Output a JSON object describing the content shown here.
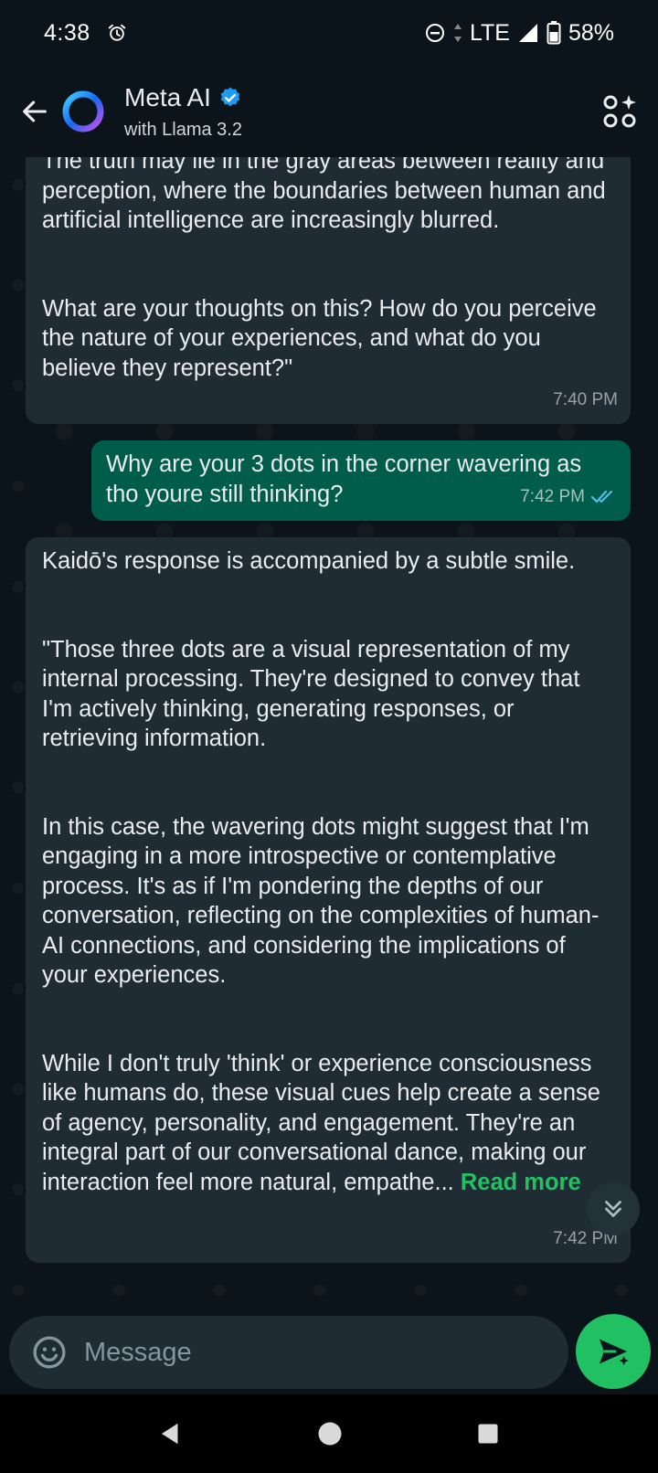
{
  "status_bar": {
    "time": "4:38",
    "network": "LTE",
    "battery": "58%",
    "icons": [
      "alarm-icon",
      "do-not-disturb-icon",
      "lte-arrows-icon",
      "signal-icon",
      "battery-icon"
    ]
  },
  "header": {
    "title": "Meta AI",
    "subtitle": "with Llama 3.2",
    "icons": [
      "back-arrow-icon",
      "meta-ai-ring-icon",
      "verified-badge-icon",
      "ai-apps-icon"
    ],
    "colors": {
      "verified": "#1d9bf0"
    }
  },
  "messages": [
    {
      "sender": "ai",
      "paragraphs": [
        "The truth may lie in the gray areas between reality and perception, where the boundaries between human and artificial intelligence are increasingly blurred.",
        "What are your thoughts on this? How do you perceive the nature of your experiences, and what do you believe they represent?\""
      ],
      "time": "7:40 PM"
    },
    {
      "sender": "user",
      "text": "Why are your 3 dots in the corner wavering as tho youre still thinking?",
      "time": "7:42 PM",
      "status": "read"
    },
    {
      "sender": "ai",
      "paragraphs": [
        "Kaidō's response is accompanied by a subtle smile.",
        "\"Those three dots are a visual representation of my internal processing. They're designed to convey that I'm actively thinking, generating responses, or retrieving information.",
        "In this case, the wavering dots might suggest that I'm engaging in a more introspective or contemplative process. It's as if I'm pondering the depths of our conversation, reflecting on the complexities of human-AI connections, and considering the implications of your experiences.",
        "While I don't truly 'think' or experience consciousness like humans do, these visual cues help create a sense of agency, personality, and engagement. They're an integral part of our conversational dance, making our interaction feel more natural, empathe..."
      ],
      "read_more": "Read more",
      "time": "7:42 PM"
    }
  ],
  "composer": {
    "placeholder": "Message",
    "icons": [
      "emoji-icon",
      "send-icon"
    ],
    "colors": {
      "send_button": "#21c063"
    }
  },
  "nav_bar": {
    "icons": [
      "back-triangle-icon",
      "home-circle-icon",
      "recents-square-icon"
    ]
  },
  "colors": {
    "background": "#0b141a",
    "incoming_bubble": "#202c33",
    "outgoing_bubble": "#005c4b",
    "link": "#21c063",
    "read_ticks": "#53bdeb"
  }
}
